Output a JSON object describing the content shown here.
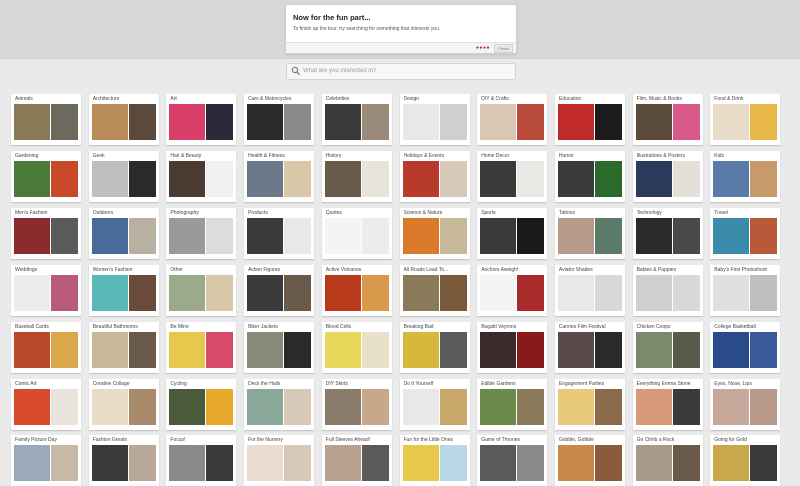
{
  "tour": {
    "title": "Now for the fun part...",
    "body": "To finish up the tour, try searching for something that interests you.",
    "dots": "●●●●",
    "finish_label": "Finish"
  },
  "search": {
    "placeholder": "What are you interested in?",
    "value": ""
  },
  "categories": [
    {
      "label": "Animals",
      "colors": [
        "#8a7a58",
        "#6b6a5c"
      ]
    },
    {
      "label": "Architecture",
      "colors": [
        "#b98b58",
        "#5b4a3c"
      ]
    },
    {
      "label": "Art",
      "colors": [
        "#d8406a",
        "#2c2a3a"
      ]
    },
    {
      "label": "Cars & Motorcycles",
      "colors": [
        "#2a2a2a",
        "#8a8a8a"
      ]
    },
    {
      "label": "Celebrities",
      "colors": [
        "#3a3a3a",
        "#9a8a7a"
      ]
    },
    {
      "label": "Design",
      "colors": [
        "#e8e8e8",
        "#cfcfcf"
      ]
    },
    {
      "label": "DIY & Crafts",
      "colors": [
        "#d9c8b4",
        "#b84a3a"
      ]
    },
    {
      "label": "Education",
      "colors": [
        "#c02a2a",
        "#1c1c1c"
      ]
    },
    {
      "label": "Film, Music & Books",
      "colors": [
        "#5a4a3a",
        "#d85a8a"
      ]
    },
    {
      "label": "Food & Drink",
      "colors": [
        "#e8dcc8",
        "#e8b84a"
      ]
    },
    {
      "label": "Gardening",
      "colors": [
        "#4a7a3a",
        "#c84a2a"
      ]
    },
    {
      "label": "Geek",
      "colors": [
        "#bfbfbf",
        "#2a2a2a"
      ]
    },
    {
      "label": "Hair & Beauty",
      "colors": [
        "#4a3a32",
        "#f0f0f0"
      ]
    },
    {
      "label": "Health & Fitness",
      "colors": [
        "#6a7a8a",
        "#d8c8a8"
      ]
    },
    {
      "label": "History",
      "colors": [
        "#6a5a4a",
        "#e8e4dc"
      ]
    },
    {
      "label": "Holidays & Events",
      "colors": [
        "#b83a2a",
        "#d8c8b8"
      ]
    },
    {
      "label": "Home Decor",
      "colors": [
        "#3a3a3a",
        "#e8e8e4"
      ]
    },
    {
      "label": "Humor",
      "colors": [
        "#3a3a3a",
        "#2a6a2a"
      ]
    },
    {
      "label": "Illustrations & Posters",
      "colors": [
        "#2a3a5a",
        "#e4e0d8"
      ]
    },
    {
      "label": "Kids",
      "colors": [
        "#5a7aaa",
        "#c89a6a"
      ]
    },
    {
      "label": "Men's Fashion",
      "colors": [
        "#8a2a2a",
        "#5a5a5a"
      ]
    },
    {
      "label": "Outdoors",
      "colors": [
        "#4a6a9a",
        "#b8b0a0"
      ]
    },
    {
      "label": "Photography",
      "colors": [
        "#9a9a9a",
        "#dcdcdc"
      ]
    },
    {
      "label": "Products",
      "colors": [
        "#3a3a3a",
        "#e8e8e8"
      ]
    },
    {
      "label": "Quotes",
      "colors": [
        "#f4f4f4",
        "#ececec"
      ]
    },
    {
      "label": "Science & Nature",
      "colors": [
        "#d87a2a",
        "#c8b89a"
      ]
    },
    {
      "label": "Sports",
      "colors": [
        "#3a3a3a",
        "#1a1a1a"
      ]
    },
    {
      "label": "Tattoos",
      "colors": [
        "#b89a8a",
        "#5a7a6a"
      ]
    },
    {
      "label": "Technology",
      "colors": [
        "#2a2a2a",
        "#4a4a4a"
      ]
    },
    {
      "label": "Travel",
      "colors": [
        "#3a8aaa",
        "#b85a3a"
      ]
    },
    {
      "label": "Weddings",
      "colors": [
        "#ececec",
        "#b85a7a"
      ]
    },
    {
      "label": "Women's Fashion",
      "colors": [
        "#5ab8b8",
        "#6a4a3a"
      ]
    },
    {
      "label": "Other",
      "colors": [
        "#9aaa8a",
        "#d8c8a8"
      ]
    },
    {
      "label": "Action Figures",
      "colors": [
        "#3a3a3a",
        "#6a5a4a"
      ]
    },
    {
      "label": "Active Volcanos",
      "colors": [
        "#b83a1a",
        "#d89a4a"
      ]
    },
    {
      "label": "All Roads Lead To...",
      "colors": [
        "#8a7a5a",
        "#7a5a3a"
      ]
    },
    {
      "label": "Anchors Aweigh!",
      "colors": [
        "#f4f4f4",
        "#a82a2a"
      ]
    },
    {
      "label": "Aviator Shades",
      "colors": [
        "#e8e8e8",
        "#d8d8d8"
      ]
    },
    {
      "label": "Babies & Puppies",
      "colors": [
        "#cfcfcf",
        "#d8d8d8"
      ]
    },
    {
      "label": "Baby's First Photoshoot",
      "colors": [
        "#e0e0e0",
        "#bfbfbf"
      ]
    },
    {
      "label": "Baseball Cards",
      "colors": [
        "#b84a2a",
        "#d8a84a"
      ]
    },
    {
      "label": "Beautiful Bathrooms",
      "colors": [
        "#c8b89a",
        "#6a5a4a"
      ]
    },
    {
      "label": "Be Mine",
      "colors": [
        "#e8c84a",
        "#d84a6a"
      ]
    },
    {
      "label": "Biker Jackets",
      "colors": [
        "#8a8a7a",
        "#2a2a2a"
      ]
    },
    {
      "label": "Blood Cells",
      "colors": [
        "#e8d85a",
        "#e8e0c8"
      ]
    },
    {
      "label": "Breaking Bad",
      "colors": [
        "#d8b83a",
        "#5a5a5a"
      ]
    },
    {
      "label": "Bugatti Veyrons",
      "colors": [
        "#3a2a2a",
        "#8a1a1a"
      ]
    },
    {
      "label": "Cannes Film Festival",
      "colors": [
        "#5a4a4a",
        "#2a2a2a"
      ]
    },
    {
      "label": "Chicken Coops",
      "colors": [
        "#7a8a6a",
        "#5a5a4a"
      ]
    },
    {
      "label": "College Basketball",
      "colors": [
        "#2a4a8a",
        "#3a5a9a"
      ]
    },
    {
      "label": "Comic Art",
      "colors": [
        "#d84a2a",
        "#e8e4dc"
      ]
    },
    {
      "label": "Creative Collage",
      "colors": [
        "#e8dcc8",
        "#a88a6a"
      ]
    },
    {
      "label": "Cycling",
      "colors": [
        "#4a5a3a",
        "#e8a82a"
      ]
    },
    {
      "label": "Deck the Halls",
      "colors": [
        "#8aa89a",
        "#d8c8b8"
      ]
    },
    {
      "label": "DIY Skirts",
      "colors": [
        "#8a7a6a",
        "#c8a88a"
      ]
    },
    {
      "label": "Do It Yourself",
      "colors": [
        "#e8e8e8",
        "#c8a86a"
      ]
    },
    {
      "label": "Edible Gardens",
      "colors": [
        "#6a8a4a",
        "#8a7a5a"
      ]
    },
    {
      "label": "Engagement Parties",
      "colors": [
        "#e8c87a",
        "#8a6a4a"
      ]
    },
    {
      "label": "Everything Emma Stone",
      "colors": [
        "#d89a7a",
        "#3a3a3a"
      ]
    },
    {
      "label": "Eyes, Nose, Lips",
      "colors": [
        "#c8a89a",
        "#b8988a"
      ]
    },
    {
      "label": "Family Picture Day",
      "colors": [
        "#9aaab8",
        "#c8b8a8"
      ]
    },
    {
      "label": "Fashion Greats",
      "colors": [
        "#3a3a3a",
        "#b8a89a"
      ]
    },
    {
      "label": "Focus!",
      "colors": [
        "#8a8a8a",
        "#3a3a3a"
      ]
    },
    {
      "label": "For the Nursery",
      "colors": [
        "#e8dcd0",
        "#d8c8b8"
      ]
    },
    {
      "label": "Full Sleeves Ahead!",
      "colors": [
        "#b8a090",
        "#5a5a5a"
      ]
    },
    {
      "label": "Fun for the Little Ones",
      "colors": [
        "#e8c84a",
        "#b8d8e8"
      ]
    },
    {
      "label": "Game of Thrones",
      "colors": [
        "#5a5a5a",
        "#8a8a8a"
      ]
    },
    {
      "label": "Gobble, Gobble",
      "colors": [
        "#c88a4a",
        "#8a5a3a"
      ]
    },
    {
      "label": "Go Climb a Rock",
      "colors": [
        "#a89a8a",
        "#6a5a4a"
      ]
    },
    {
      "label": "Going for Gold",
      "colors": [
        "#c8a84a",
        "#3a3a3a"
      ]
    }
  ]
}
